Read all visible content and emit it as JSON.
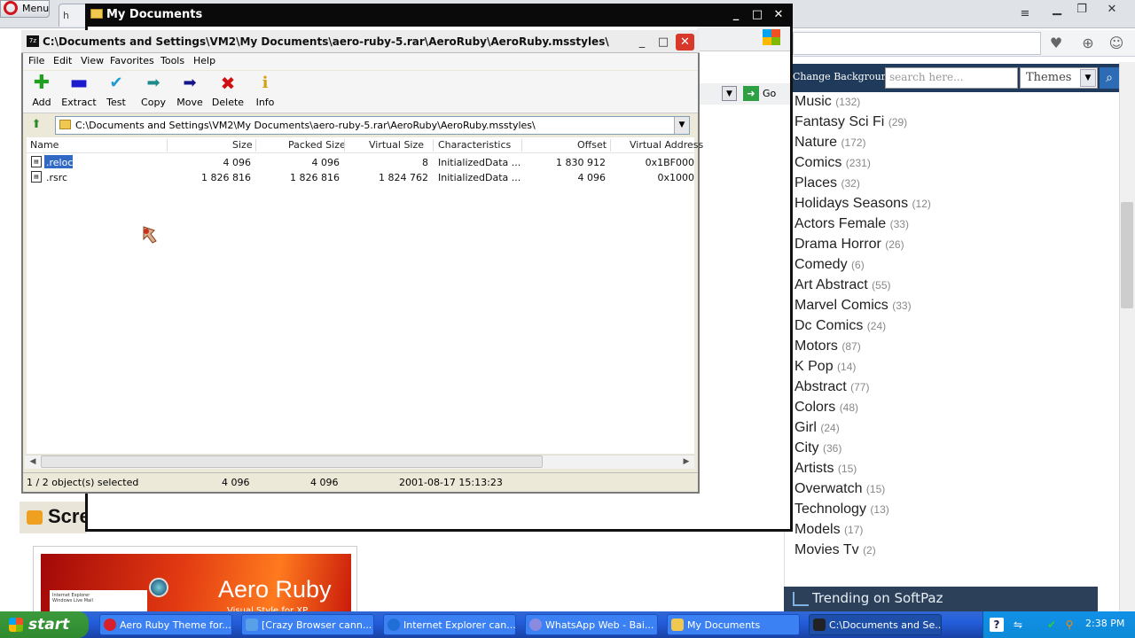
{
  "browser": {
    "menu_label": "Menu",
    "tab_label": "h",
    "site": {
      "change_background": "Change Background",
      "search_placeholder": "search here...",
      "themes_select": "Themes",
      "categories": [
        {
          "name": "Music",
          "count": "(132)"
        },
        {
          "name": "Fantasy Sci Fi",
          "count": "(29)"
        },
        {
          "name": "Nature",
          "count": "(172)"
        },
        {
          "name": "Comics",
          "count": "(231)"
        },
        {
          "name": "Places",
          "count": "(32)"
        },
        {
          "name": "Holidays Seasons",
          "count": "(12)"
        },
        {
          "name": "Actors Female",
          "count": "(33)"
        },
        {
          "name": "Drama Horror",
          "count": "(26)"
        },
        {
          "name": "Comedy",
          "count": "(6)"
        },
        {
          "name": "Art Abstract",
          "count": "(55)"
        },
        {
          "name": "Marvel Comics",
          "count": "(33)"
        },
        {
          "name": "Dc Comics",
          "count": "(24)"
        },
        {
          "name": "Motors",
          "count": "(87)"
        },
        {
          "name": "K Pop",
          "count": "(14)"
        },
        {
          "name": "Abstract",
          "count": "(77)"
        },
        {
          "name": "Colors",
          "count": "(48)"
        },
        {
          "name": "Girl",
          "count": "(24)"
        },
        {
          "name": "City",
          "count": "(36)"
        },
        {
          "name": "Artists",
          "count": "(15)"
        },
        {
          "name": "Overwatch",
          "count": "(15)"
        },
        {
          "name": "Technology",
          "count": "(13)"
        },
        {
          "name": "Models",
          "count": "(17)"
        },
        {
          "name": "Movies Tv",
          "count": "(2)"
        }
      ],
      "trending_label": "Trending on SoftPaz",
      "screenshot_banner": "Scre",
      "thumb_title": "Aero Ruby",
      "thumb_subtitle": "Visual Style for XP",
      "thumb_menu_item1": "Internet Explorer",
      "thumb_menu_item2": "Windows Live Mail"
    }
  },
  "mydocs": {
    "title": "My Documents",
    "go_label": "Go"
  },
  "zip": {
    "title": "C:\\Documents and Settings\\VM2\\My Documents\\aero-ruby-5.rar\\AeroRuby\\AeroRuby.msstyles\\",
    "menu": [
      "File",
      "Edit",
      "View",
      "Favorites",
      "Tools",
      "Help"
    ],
    "toolbar": [
      {
        "label": "Add",
        "icon": "add-icon",
        "color": "#1fa01f"
      },
      {
        "label": "Extract",
        "icon": "extract-icon",
        "color": "#1a1ad0"
      },
      {
        "label": "Test",
        "icon": "test-icon",
        "color": "#1e9ad6"
      },
      {
        "label": "Copy",
        "icon": "copy-icon",
        "color": "#1e8a8a"
      },
      {
        "label": "Move",
        "icon": "move-icon",
        "color": "#14148a"
      },
      {
        "label": "Delete",
        "icon": "delete-icon",
        "color": "#d01010"
      },
      {
        "label": "Info",
        "icon": "info-icon",
        "color": "#d4a010"
      }
    ],
    "path": "C:\\Documents and Settings\\VM2\\My Documents\\aero-ruby-5.rar\\AeroRuby\\AeroRuby.msstyles\\",
    "columns": [
      "Name",
      "Size",
      "Packed Size",
      "Virtual Size",
      "Characteristics",
      "Offset",
      "Virtual Address"
    ],
    "rows": [
      {
        "name": ".reloc",
        "size": "4 096",
        "packed": "4 096",
        "virtual": "8",
        "chars": "InitializedData ...",
        "offset": "1 830 912",
        "vaddr": "0x1BF000",
        "selected": true
      },
      {
        "name": ".rsrc",
        "size": "1 826 816",
        "packed": "1 826 816",
        "virtual": "1 824 762",
        "chars": "InitializedData ...",
        "offset": "4 096",
        "vaddr": "0x1000",
        "selected": false
      }
    ],
    "status": {
      "selection": "1 / 2 object(s) selected",
      "size": "4 096",
      "packed": "4 096",
      "date": "2001-08-17 15:13:23"
    }
  },
  "taskbar": {
    "start_label": "start",
    "tasks": [
      {
        "label": "Aero Ruby Theme for...",
        "color": "#d8202a"
      },
      {
        "label": "[Crazy Browser cann...",
        "color": "#5aa0e8"
      },
      {
        "label": "Internet Explorer can...",
        "color": "#1f6fd6"
      },
      {
        "label": "WhatsApp Web - Bai...",
        "color": "#8a8ae0"
      },
      {
        "label": "My Documents",
        "color": "#f0c850"
      },
      {
        "label": "C:\\Documents and Se...",
        "color": "#222222"
      }
    ],
    "clock": "2:38 PM"
  }
}
